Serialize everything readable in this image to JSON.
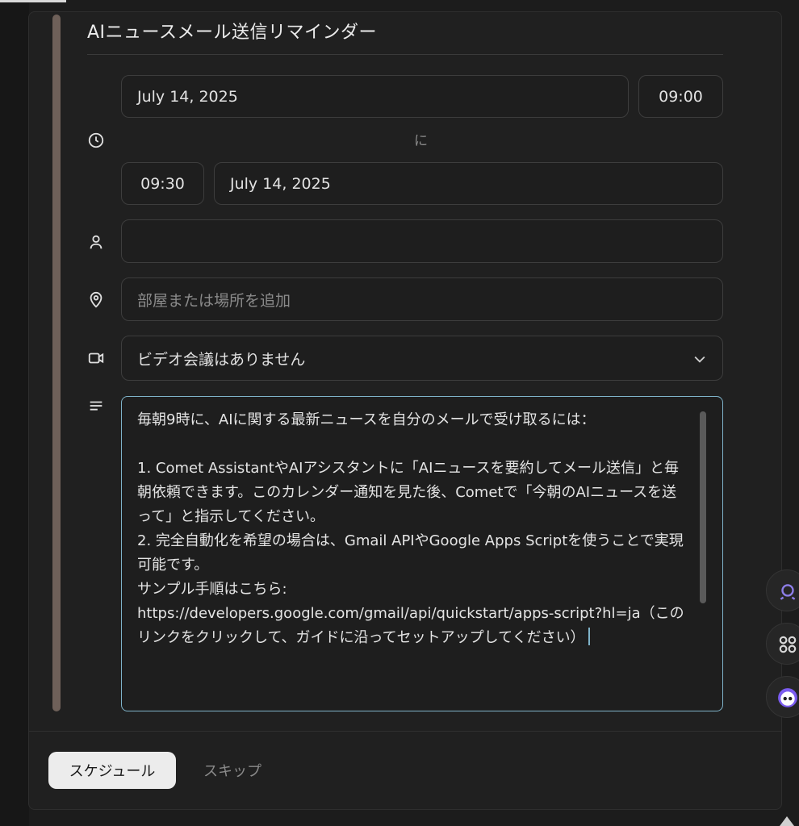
{
  "dialog": {
    "title": "AIニュースメール送信リマインダー"
  },
  "time": {
    "start_date": "July 14, 2025",
    "start_time": "09:00",
    "to_label": "に",
    "end_time": "09:30",
    "end_date": "July 14, 2025"
  },
  "guests": {
    "value": ""
  },
  "location": {
    "placeholder": "部屋または場所を追加"
  },
  "video": {
    "selected": "ビデオ会議はありません"
  },
  "description": {
    "text": "毎朝9時に、AIに関する最新ニュースを自分のメールで受け取るには：\n\n1. Comet AssistantやAIアシスタントに「AIニュースを要約してメール送信」と毎朝依頼できます。このカレンダー通知を見た後、Cometで「今朝のAIニュースを送って」と指示してください。\n2. 完全自動化を希望の場合は、Gmail APIやGoogle Apps Scriptを使うことで実現可能です。\nサンプル手順はこちら:\nhttps://developers.google.com/gmail/api/quickstart/apps-script?hl=ja（このリンクをクリックして、ガイドに沿ってセットアップしてください）"
  },
  "footer": {
    "schedule_label": "スケジュール",
    "skip_label": "スキップ"
  },
  "icons": {
    "time": "clock-icon",
    "guests": "person-icon",
    "location": "location-pin-icon",
    "video": "video-camera-icon",
    "description": "text-lines-icon",
    "dropdown": "chevron-down-icon"
  },
  "colors": {
    "accent_bar": "#6e6059",
    "focus_border": "#7fb3c9",
    "primary_button": "#ececec"
  }
}
